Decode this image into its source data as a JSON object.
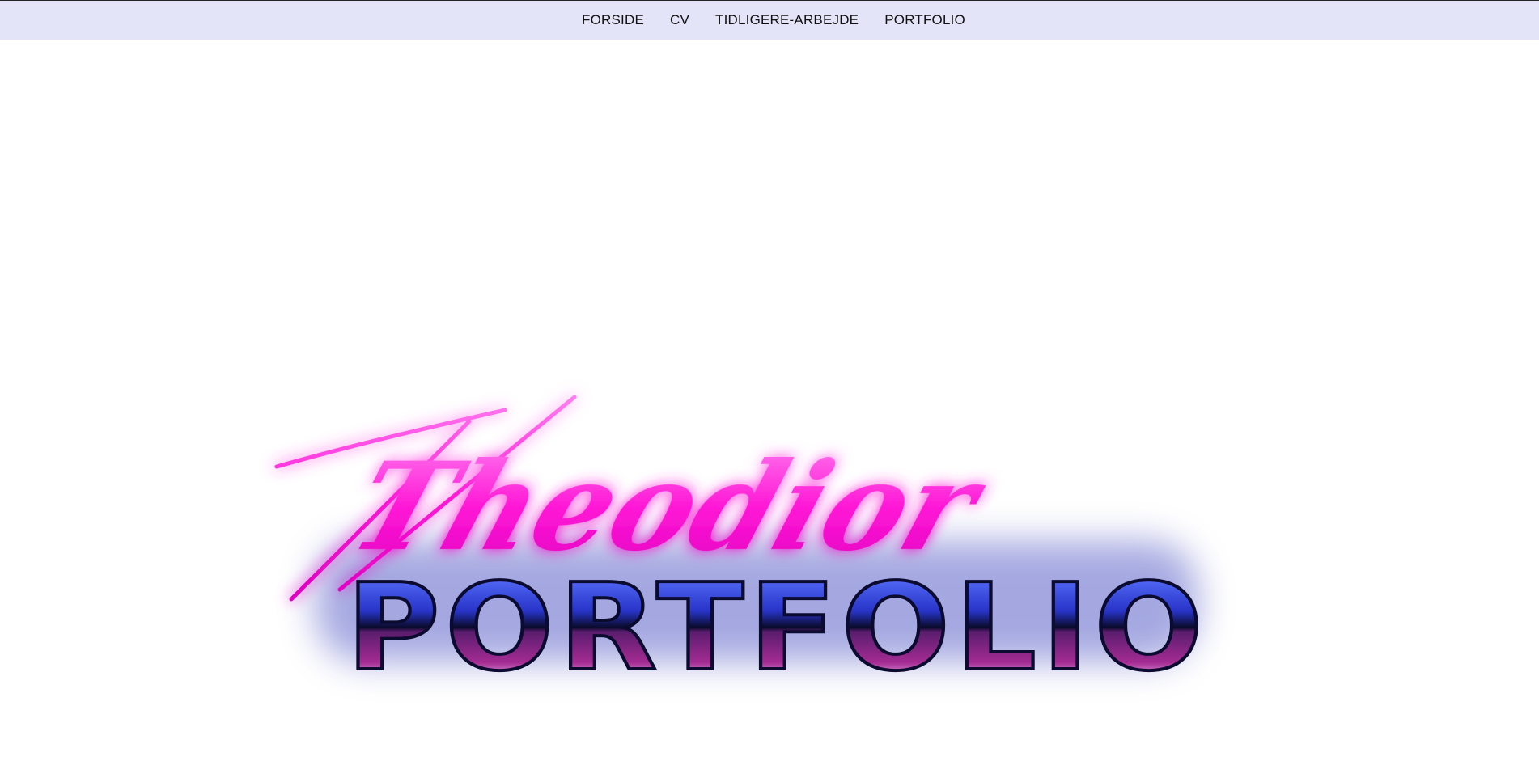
{
  "nav": {
    "items": [
      {
        "label": "FORSIDE"
      },
      {
        "label": "CV"
      },
      {
        "label": "TIDLIGERE-ARBEJDE"
      },
      {
        "label": "PORTFOLIO"
      }
    ]
  },
  "logo": {
    "script_text": "Theodior",
    "main_text": "PORTFOLIO"
  },
  "colors": {
    "nav_background": "#e3e4f8",
    "script_pink": "#ff1ed6",
    "chrome_blue": "#3a4fd8",
    "chrome_purple": "#8a1f6e"
  }
}
